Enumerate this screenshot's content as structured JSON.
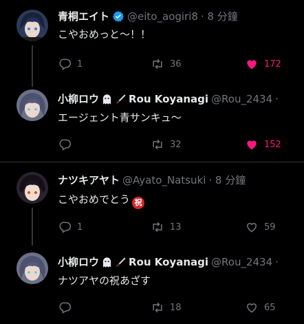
{
  "tweets": [
    {
      "name": "青桐エイト",
      "handle": "@eito_aogiri8",
      "time": "· 8 分鐘",
      "text": "こやおめっと～！！",
      "reply_count": "1",
      "retweet_count": "36",
      "like_count": "172",
      "liked": true,
      "verified": true
    },
    {
      "name": "小柳ロウ",
      "name_suffix": "Rou Koyanagi",
      "handle": "@Rou_2434",
      "time": "·",
      "text": "エージェント青サンキュ～",
      "reply_count": "",
      "retweet_count": "32",
      "like_count": "152",
      "liked": true
    },
    {
      "name": "ナツキアヤト",
      "handle": "@Ayato_Natsuki",
      "time": "· 8 分鐘",
      "text": "こやおめでとう",
      "reply_count": "1",
      "retweet_count": "13",
      "like_count": "59",
      "liked": false
    },
    {
      "name": "小柳ロウ",
      "name_suffix": "Rou Koyanagi",
      "handle": "@Rou_2434",
      "time": "·",
      "text": "ナツアヤの祝あざす",
      "reply_count": "",
      "retweet_count": "18",
      "like_count": "65",
      "liked": false
    }
  ],
  "iwai_char": "祝",
  "colors": {
    "like": "#f91880",
    "muted": "#71767b",
    "verified": "#1d9bf0"
  }
}
